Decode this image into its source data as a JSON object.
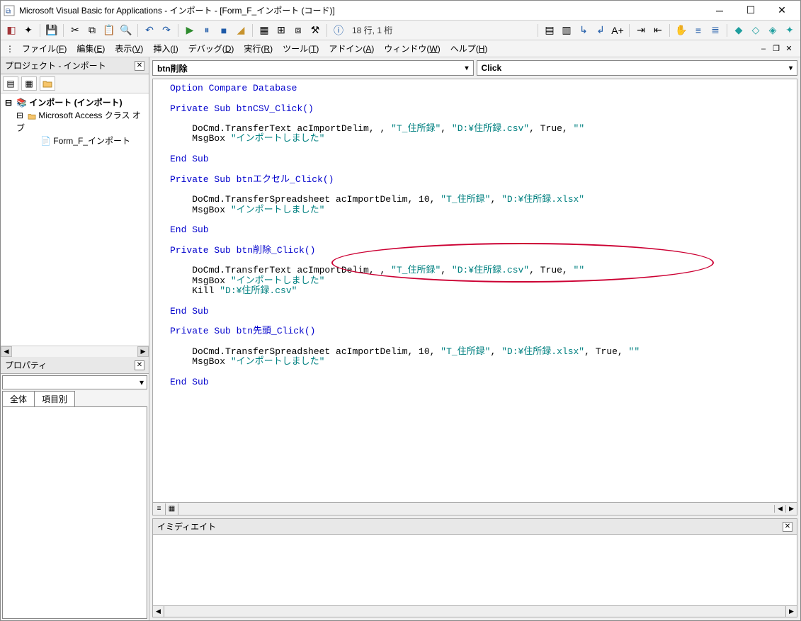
{
  "titlebar": {
    "title": "Microsoft Visual Basic for Applications - インポート - [Form_F_インポート (コード)]"
  },
  "toolbar": {
    "status": "18 行, 1 桁"
  },
  "menubar": {
    "items": [
      {
        "label": "ファイル(",
        "key": "F",
        "suffix": ")"
      },
      {
        "label": "編集(",
        "key": "E",
        "suffix": ")"
      },
      {
        "label": "表示(",
        "key": "V",
        "suffix": ")"
      },
      {
        "label": "挿入(",
        "key": "I",
        "suffix": ")"
      },
      {
        "label": "デバッグ(",
        "key": "D",
        "suffix": ")"
      },
      {
        "label": "実行(",
        "key": "R",
        "suffix": ")"
      },
      {
        "label": "ツール(",
        "key": "T",
        "suffix": ")"
      },
      {
        "label": "アドイン(",
        "key": "A",
        "suffix": ")"
      },
      {
        "label": "ウィンドウ(",
        "key": "W",
        "suffix": ")"
      },
      {
        "label": "ヘルプ(",
        "key": "H",
        "suffix": ")"
      }
    ]
  },
  "project": {
    "panel_title": "プロジェクト - インポート",
    "root": "インポート (インポート)",
    "folder": "Microsoft Access クラス オブ",
    "form": "Form_F_インポート"
  },
  "properties": {
    "panel_title": "プロパティ",
    "tab_all": "全体",
    "tab_cat": "項目別"
  },
  "combos": {
    "object": "btn削除",
    "event": "Click"
  },
  "code": {
    "l1": "Option Compare Database",
    "l2": "Private Sub btnCSV_Click()",
    "l3a": "    DoCmd.TransferText acImportDelim, , ",
    "l3b": "\"T_住所録\"",
    "l3c": ", ",
    "l3d": "\"D:¥住所録.csv\"",
    "l3e": ", True, ",
    "l3f": "\"\"",
    "l4a": "    MsgBox ",
    "l4b": "\"インポートしました\"",
    "l5": "End Sub",
    "l6": "Private Sub btnエクセル_Click()",
    "l7a": "    DoCmd.TransferSpreadsheet acImportDelim, 10, ",
    "l7b": "\"T_住所録\"",
    "l7c": ", ",
    "l7d": "\"D:¥住所録.xlsx\"",
    "l8a": "    MsgBox ",
    "l8b": "\"インポートしました\"",
    "l9": "End Sub",
    "l10": "Private Sub btn削除_Click()",
    "l11a": "    DoCmd.TransferText acImportDelim, , ",
    "l11b": "\"T_住所録\"",
    "l11c": ", ",
    "l11d": "\"D:¥住所録.csv\"",
    "l11e": ", True, ",
    "l11f": "\"\"",
    "l12a": "    MsgBox ",
    "l12b": "\"インポートしました\"",
    "l13a": "    Kill ",
    "l13b": "\"D:¥住所録.csv\"",
    "l14": "End Sub",
    "l15": "Private Sub btn先頭_Click()",
    "l16a": "    DoCmd.TransferSpreadsheet acImportDelim, 10, ",
    "l16b": "\"T_住所録\"",
    "l16c": ", ",
    "l16d": "\"D:¥住所録.xlsx\"",
    "l16e": ", True, ",
    "l16f": "\"\"",
    "l17a": "    MsgBox ",
    "l17b": "\"インポートしました\"",
    "l18": "End Sub"
  },
  "immediate": {
    "title": "イミディエイト"
  }
}
